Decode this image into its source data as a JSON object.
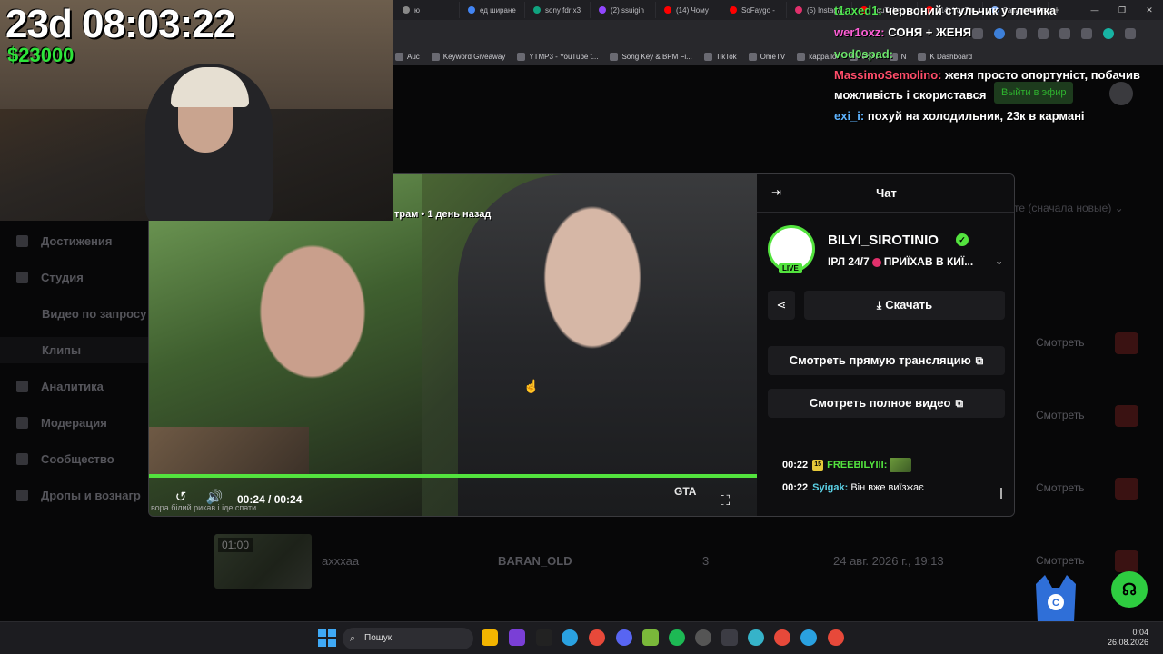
{
  "browser": {
    "tabs": [
      {
        "label": "ю",
        "color": "#888"
      },
      {
        "label": "ед ширане",
        "color": "#4285f4"
      },
      {
        "label": "sony fdr x3",
        "color": "#10a37f"
      },
      {
        "label": "(2) ssuigin",
        "color": "#9146ff"
      },
      {
        "label": "(14) Чому",
        "color": "#ff0000"
      },
      {
        "label": "SoFaygo -",
        "color": "#ff0000"
      },
      {
        "label": "(5) Instagra",
        "color": "#e1306c"
      },
      {
        "label": "YouTube",
        "color": "#ff0000"
      },
      {
        "label": "(14) YouTu",
        "color": "#ff0000"
      },
      {
        "label": "Запитати Gemini",
        "color": "#8ab4f8"
      }
    ],
    "bookmarks": [
      "Auc",
      "Keyword Giveaway",
      "YTMP3 - YouTube t...",
      "Song Key & BPM Fi...",
      "TikTok",
      "OmeTV",
      "kappa.lol",
      "Grok",
      "N",
      "K Dashboard"
    ]
  },
  "stream_overlay": {
    "timer": "23d 08:03:22",
    "money": "$23000"
  },
  "overlay_chat": [
    {
      "user": "t1axed1:",
      "user_color": "#4fe34f",
      "text": "червоний стульчик у глечика"
    },
    {
      "user": "wer1oxz:",
      "user_color": "#ff5fd7",
      "text": "СОНЯ + ЖЕНЯ"
    },
    {
      "user": "vod0spad:",
      "user_color": "#6be36b",
      "text": ""
    },
    {
      "user": "MassimoSemolino:",
      "user_color": "#ff4d6a",
      "text": "женя просто опортуніст, побачив можливість і скористався"
    },
    {
      "user": "exi_i:",
      "user_color": "#5fb4ff",
      "text": "похуй на холодильник, 23к в кармані"
    }
  ],
  "go_air_label": "Выйти в эфир",
  "sidebar": {
    "items": [
      "Достижения",
      "Студия",
      "Видео по запросу",
      "Клипы",
      "Аналитика",
      "Модерация",
      "Сообщество",
      "Дропы и вознагр"
    ]
  },
  "sort_label": "те (сначала новые)",
  "rows": {
    "watch_label": "Смотреть"
  },
  "clip_row": {
    "duration": "01:00",
    "title": "ахххаа",
    "author": "BARAN_OLD",
    "views": "3",
    "date": "24 авг. 2026 г., 19:13"
  },
  "modal": {
    "video": {
      "top_caption": "трам • 1 день назад",
      "time": "00:24 / 00:24",
      "progress_fraction": 1.0,
      "logo": "GTA",
      "bottom_caption": "вора білий рикав і іде спати"
    },
    "panel": {
      "title": "Чат",
      "channel_name": "BILYI_SIROTINIO",
      "live_label": "LIVE",
      "subtitle_prefix": "ІРЛ 24/7",
      "subtitle_suffix": "ПРИЇХАВ В КИЇ...",
      "download_label": "Скачать",
      "watch_live_label": "Смотреть прямую трансляцию",
      "watch_full_label": "Смотреть полное видео",
      "chat": [
        {
          "time": "00:22",
          "badge": "15",
          "user": "FREEBILYIII:",
          "user_color": "#53e33e",
          "text": ""
        },
        {
          "time": "00:22",
          "badge": "",
          "user": "Syigak:",
          "user_color": "#5bd1e6",
          "text": "Він вже виїзжає"
        }
      ]
    }
  },
  "taskbar": {
    "search_placeholder": "Пошук",
    "time": "0:04",
    "date": "26.08.2026"
  }
}
